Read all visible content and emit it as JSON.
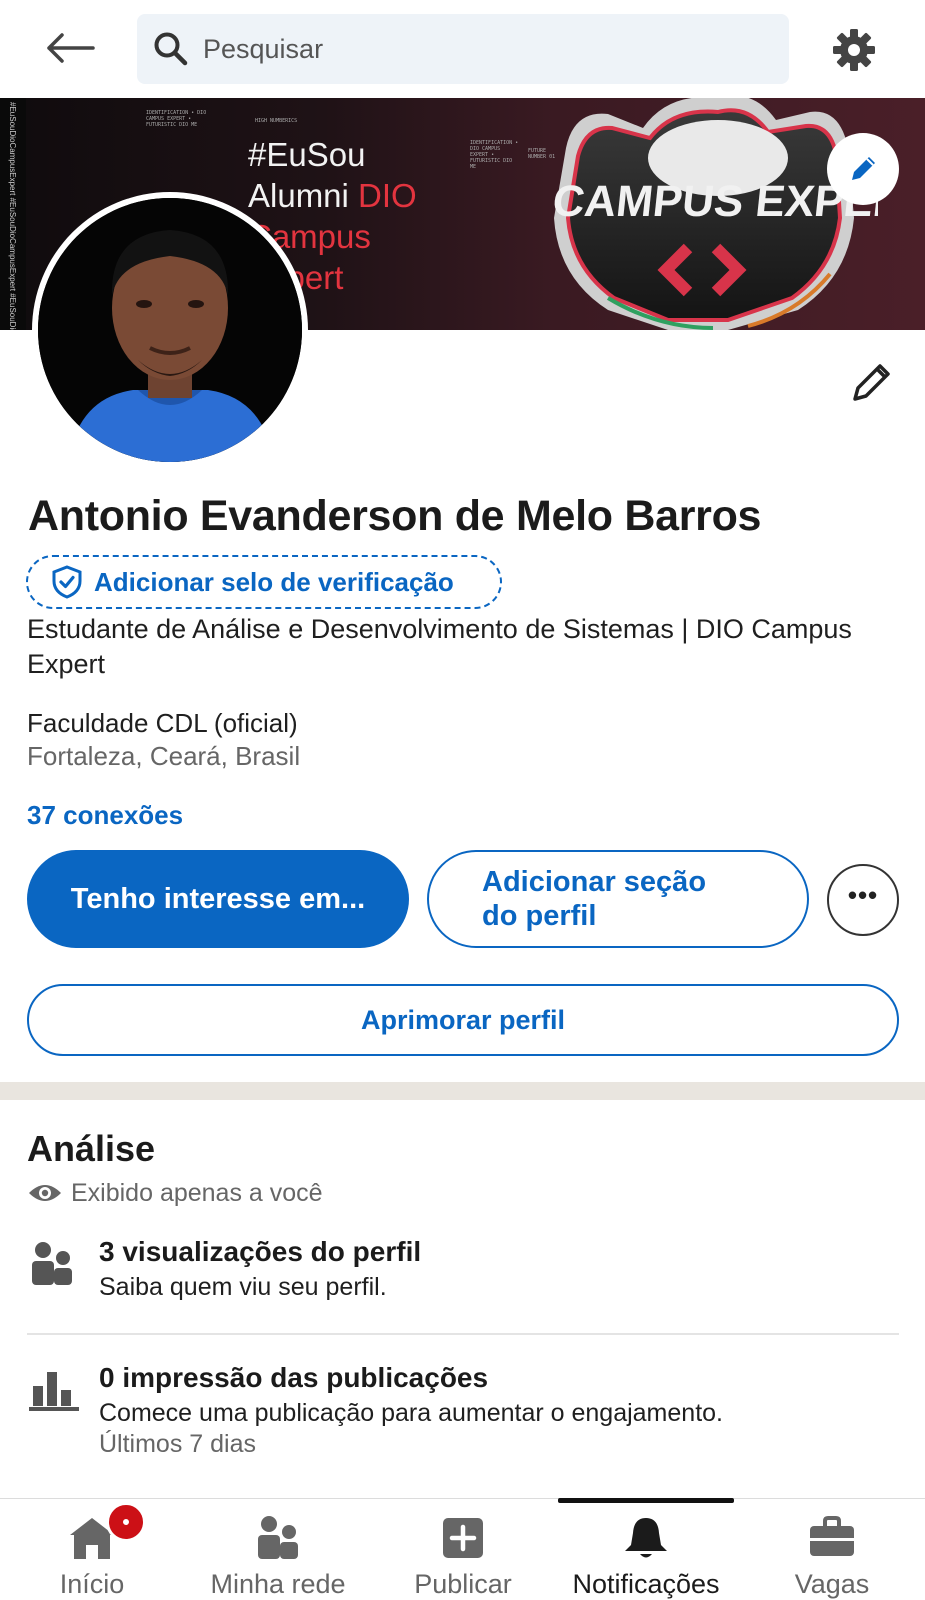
{
  "search": {
    "placeholder": "Pesquisar"
  },
  "banner": {
    "hashtag_line1": "#EuSou",
    "hashtag_line2_white": "Alumni ",
    "hashtag_line2_red": "DIO",
    "hashtag_line3": "Campus",
    "hashtag_line4": "Expert",
    "logo_text": "DIO CAMPUS EXPERT",
    "side_text": "#EuSouDioCampusExpert #EuSouDioCampusExpert #EuSouDio",
    "tiny_1": "IDENTIFICATION • DIO CAMPUS EXPERT • FUTURISTIC DIO ME",
    "tiny_2": "HIGH NUMBERICS",
    "tiny_3": "IDENTIFICATION • DIO CAMPUS EXPERT • FUTURISTIC DIO ME",
    "tiny_4": "FUTURE NUMBER 01"
  },
  "profile": {
    "name": "Antonio Evanderson de Melo Barros",
    "verify_label": "Adicionar selo de verificação",
    "headline": "Estudante de Análise e Desenvolvimento de Sistemas | DIO Campus Expert",
    "organization": "Faculdade CDL (oficial)",
    "location": "Fortaleza, Ceará, Brasil",
    "connections": "37 conexões"
  },
  "actions": {
    "primary": "Tenho interesse em...",
    "secondary": "Adicionar seção do perfil",
    "more": "•••",
    "improve": "Aprimorar perfil"
  },
  "analysis": {
    "title": "Análise",
    "visibility": "Exibido apenas a você",
    "stats": [
      {
        "title": "3 visualizações do perfil",
        "subtitle": "Saiba quem viu seu perfil."
      },
      {
        "title": "0 impressão das publicações",
        "subtitle": "Comece uma publicação para aumentar o engajamento.",
        "note": "Últimos 7 dias"
      }
    ]
  },
  "nav": {
    "items": [
      {
        "label": "Início",
        "icon": "home-icon"
      },
      {
        "label": "Minha rede",
        "icon": "network-icon"
      },
      {
        "label": "Publicar",
        "icon": "post-icon"
      },
      {
        "label": "Notificações",
        "icon": "bell-icon"
      },
      {
        "label": "Vagas",
        "icon": "briefcase-icon"
      }
    ],
    "active": "Notificações"
  },
  "colors": {
    "accent": "#0a66c2",
    "badge": "#cc1016",
    "banner_red": "#e3343f"
  }
}
